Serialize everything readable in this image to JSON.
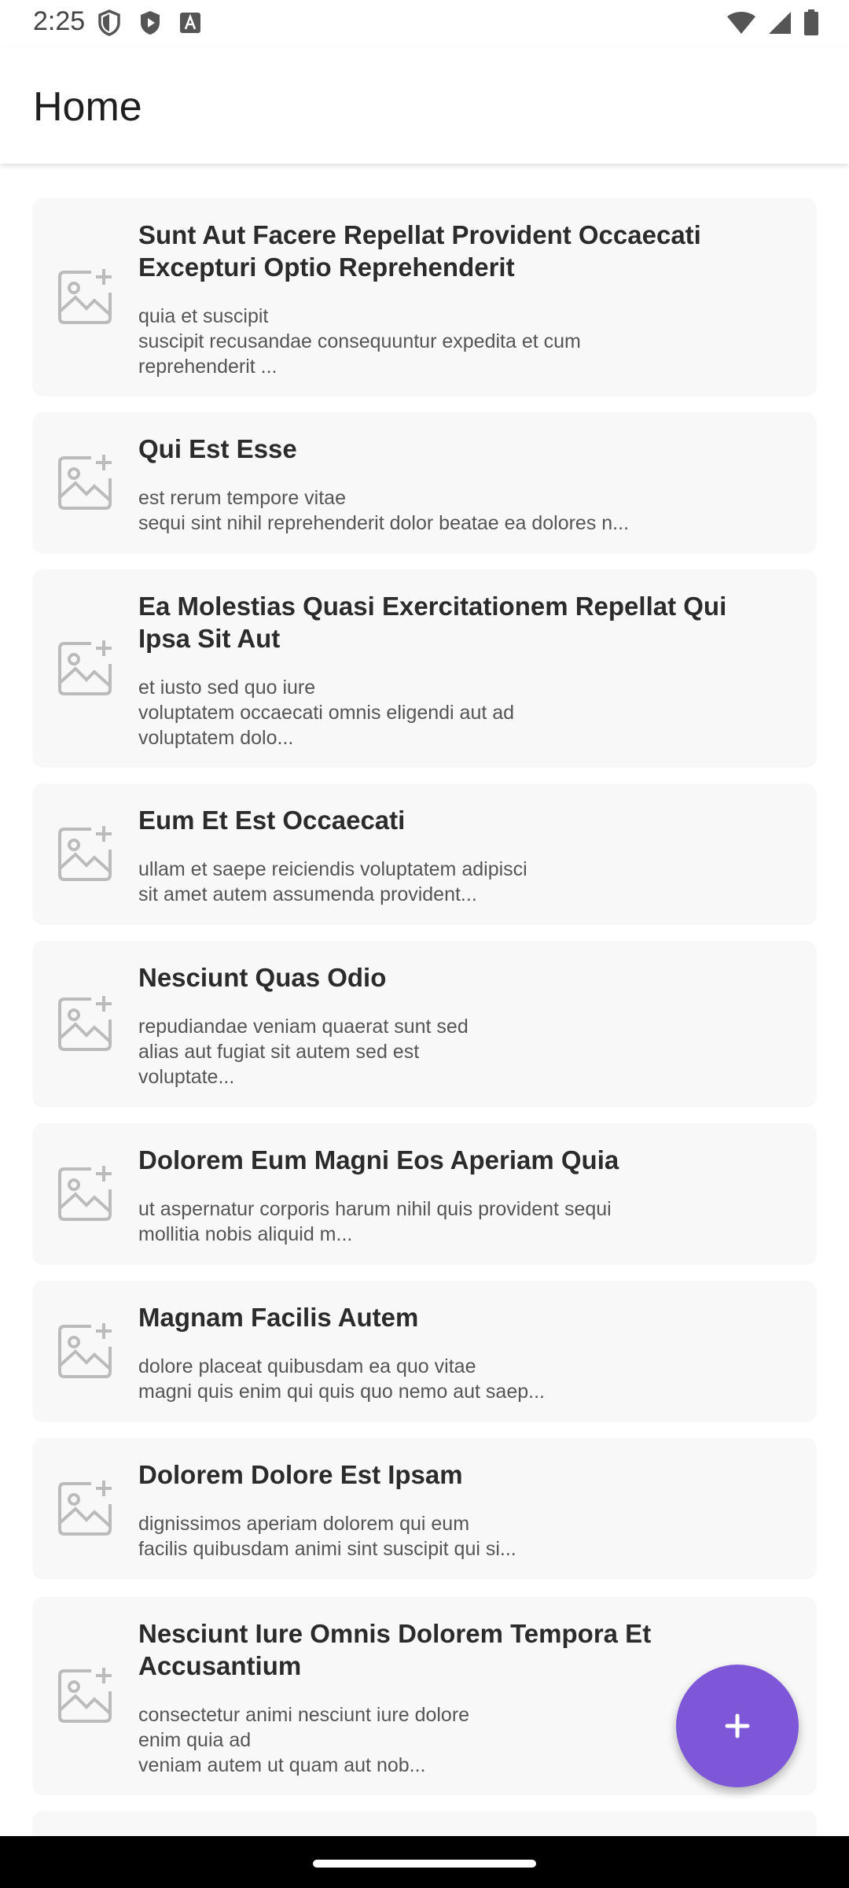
{
  "status_bar": {
    "time": "2:25",
    "left_icons": [
      "shield-icon",
      "play-protect-icon",
      "text-icon"
    ],
    "right_icons": [
      "wifi-icon",
      "cellular-icon",
      "battery-icon"
    ]
  },
  "app_bar": {
    "title": "Home"
  },
  "posts": [
    {
      "title": "Sunt Aut Facere Repellat Provident Occaecati Excepturi Optio Reprehenderit",
      "body": "quia et suscipit\nsuscipit recusandae consequuntur expedita et cum\nreprehenderit ..."
    },
    {
      "title": "Qui Est Esse",
      "body": "est rerum tempore vitae\nsequi sint nihil reprehenderit dolor beatae ea dolores n..."
    },
    {
      "title": "Ea Molestias Quasi Exercitationem Repellat Qui Ipsa Sit Aut",
      "body": "et iusto sed quo iure\nvoluptatem occaecati omnis eligendi aut ad\nvoluptatem dolo..."
    },
    {
      "title": "Eum Et Est Occaecati",
      "body": "ullam et saepe reiciendis voluptatem adipisci\nsit amet autem assumenda provident..."
    },
    {
      "title": "Nesciunt Quas Odio",
      "body": "repudiandae veniam quaerat sunt sed\nalias aut fugiat sit autem sed est\nvoluptate..."
    },
    {
      "title": "Dolorem Eum Magni Eos Aperiam Quia",
      "body": "ut aspernatur corporis harum nihil quis provident sequi\nmollitia nobis aliquid m..."
    },
    {
      "title": "Magnam Facilis Autem",
      "body": "dolore placeat quibusdam ea quo vitae\nmagni quis enim qui quis quo nemo aut saep..."
    },
    {
      "title": "Dolorem Dolore Est Ipsam",
      "body": "dignissimos aperiam dolorem qui eum\nfacilis quibusdam animi sint suscipit qui si..."
    },
    {
      "title": "Nesciunt Iure Omnis Dolorem Tempora Et Accusantium",
      "body": "consectetur animi nesciunt iure dolore\nenim quia ad\nveniam autem ut quam aut nob..."
    }
  ],
  "thumbnail_icon": "add-photo-icon",
  "fab": {
    "icon": "plus-icon",
    "label": "+"
  },
  "colors": {
    "accent": "#7e57d9",
    "card_background": "#f8f8f8",
    "title_text": "#2b2b2b",
    "body_text": "#555555"
  }
}
